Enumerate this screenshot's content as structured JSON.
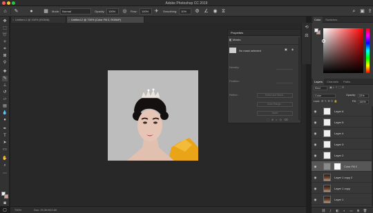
{
  "app": {
    "title": "Adobe Photoshop CC 2019"
  },
  "options": {
    "mode_label": "Mode:",
    "mode_value": "Normal",
    "opacity_label": "Opacity:",
    "opacity_value": "100%",
    "flow_label": "Flow:",
    "flow_value": "100%",
    "smoothing_label": "Smoothing:",
    "smoothing_value": "10%"
  },
  "tabs": [
    {
      "label": "Untitled-1 @ 100% (RGB/8)"
    },
    {
      "label": "Untitled-2 @ 700% (Color Fill 2, RGB/8*)"
    }
  ],
  "properties": {
    "title": "Properties",
    "subtitle": "Masks",
    "no_selection": "No mask selected",
    "density_label": "Density:",
    "feather_label": "Feather:",
    "refine_label": "Refine:",
    "select_mask_button": "Select and Mask...",
    "color_range_button": "Color Range...",
    "invert_button": "Invert"
  },
  "color_panel": {
    "tabs": [
      "Color",
      "Swatches"
    ],
    "fg_color": "#f2f2f2",
    "bg_color": "#d4a29a"
  },
  "layers_panel": {
    "tabs": [
      "Layers",
      "Channels",
      "Paths"
    ],
    "kind_label": "Kind",
    "blend_mode": "Color",
    "opacity_label": "Opacity:",
    "opacity_value": "22%",
    "lock_label": "Lock:",
    "fill_label": "Fill:",
    "fill_value": "100%",
    "layers": [
      {
        "name": "Layer 6",
        "thumb": "white"
      },
      {
        "name": "Layer 5",
        "thumb": "white"
      },
      {
        "name": "Layer 4",
        "thumb": "white"
      },
      {
        "name": "Layer 3",
        "thumb": "white"
      },
      {
        "name": "Layer 2",
        "thumb": "white"
      },
      {
        "name": "Color Fill 2",
        "thumb": "fill",
        "selected": true
      },
      {
        "name": "Layer 1 copy 2",
        "thumb": "photo"
      },
      {
        "name": "Layer 1 copy",
        "thumb": "photo"
      },
      {
        "name": "Layer 1",
        "thumb": "photo"
      }
    ]
  },
  "status": {
    "zoom": "700%",
    "doc_size": "Doc: 29.3K/922.6K"
  }
}
